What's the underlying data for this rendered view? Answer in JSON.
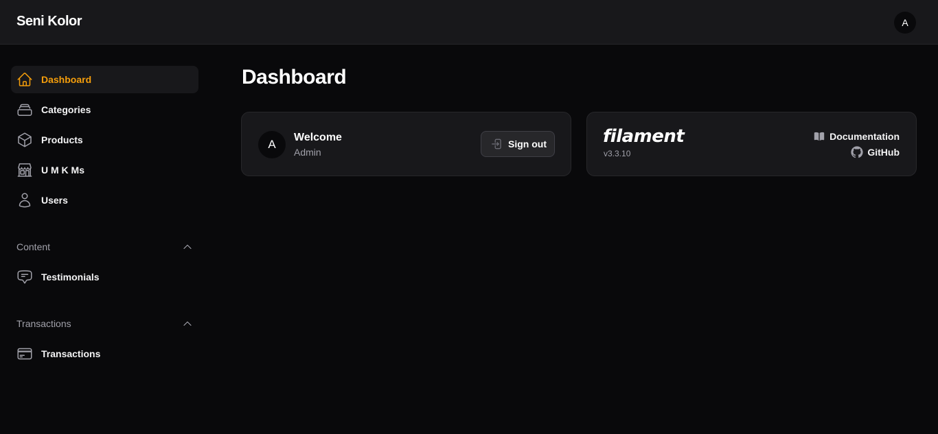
{
  "app": {
    "brand": "Seni Kolor",
    "user_initial": "A"
  },
  "sidebar": {
    "items": [
      {
        "label": "Dashboard",
        "icon": "home-icon",
        "active": true
      },
      {
        "label": "Categories",
        "icon": "rectangle-stack-icon"
      },
      {
        "label": "Products",
        "icon": "cube-icon"
      },
      {
        "label": "U M K Ms",
        "icon": "storefront-icon"
      },
      {
        "label": "Users",
        "icon": "user-icon"
      }
    ],
    "groups": [
      {
        "label": "Content",
        "items": [
          {
            "label": "Testimonials",
            "icon": "chat-bubble-icon"
          }
        ]
      },
      {
        "label": "Transactions",
        "items": [
          {
            "label": "Transactions",
            "icon": "credit-card-icon"
          }
        ]
      }
    ]
  },
  "main": {
    "title": "Dashboard",
    "account_widget": {
      "initial": "A",
      "greeting": "Welcome",
      "name": "Admin",
      "signout_label": "Sign out"
    },
    "filament_widget": {
      "logo_text": "filament",
      "version": "v3.3.10",
      "documentation_label": "Documentation",
      "github_label": "GitHub"
    }
  },
  "colors": {
    "accent": "#f59e0b",
    "background": "#09090b",
    "surface": "#18181b",
    "border": "#27272a"
  }
}
